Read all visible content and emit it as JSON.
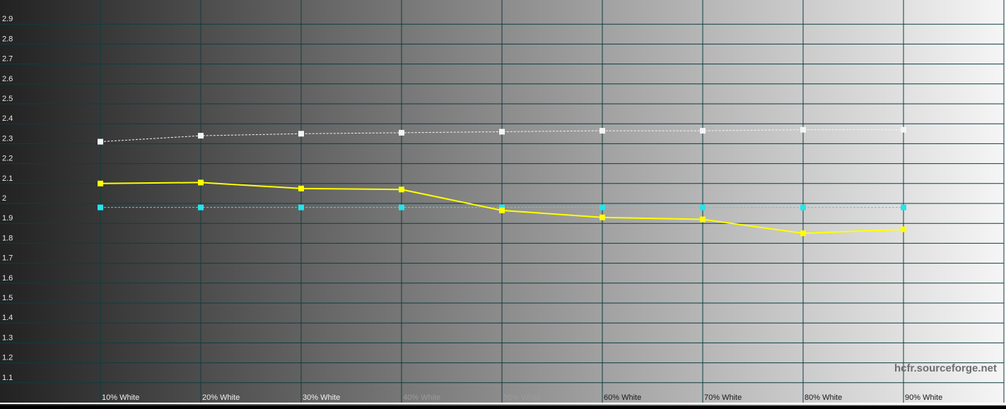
{
  "chart_data": {
    "type": "line",
    "categories": [
      "10% White",
      "20% White",
      "30% White",
      "40% White",
      "50% White",
      "60% White",
      "70% White",
      "80% White",
      "90% White"
    ],
    "y_ticks": [
      "1.1",
      "1.2",
      "1.3",
      "1.4",
      "1.5",
      "1.6",
      "1.7",
      "1.8",
      "1.9",
      "2",
      "2.1",
      "2.2",
      "2.3",
      "2.4",
      "2.5",
      "2.6",
      "2.7",
      "2.8",
      "2.9"
    ],
    "ylim": [
      1.0,
      3.0
    ],
    "grid": true,
    "legend": "none",
    "watermark": "hcfr.sourceforge.net",
    "series": [
      {
        "color": "#f4f4f4",
        "style": "dashed",
        "values": [
          2.31,
          2.34,
          2.35,
          2.355,
          2.36,
          2.365,
          2.365,
          2.37,
          2.37
        ]
      },
      {
        "color": "#22e5ee",
        "style": "dashed",
        "values": [
          1.98,
          1.98,
          1.98,
          1.98,
          1.98,
          1.98,
          1.98,
          1.98,
          1.98
        ]
      },
      {
        "color": "#ffff00",
        "style": "solid",
        "values": [
          2.1,
          2.105,
          2.075,
          2.07,
          1.965,
          1.93,
          1.92,
          1.85,
          1.87
        ]
      }
    ]
  }
}
